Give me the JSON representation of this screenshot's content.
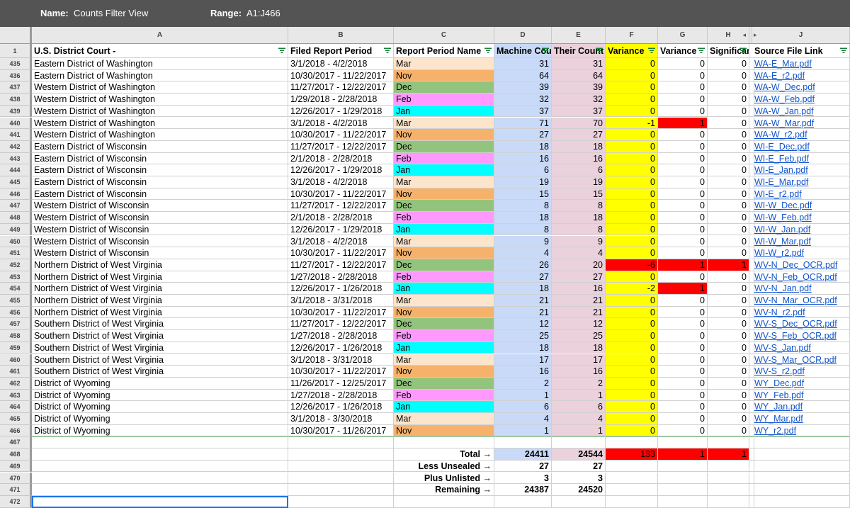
{
  "filter_view": {
    "name_label": "Name:",
    "name_value": "Counts Filter View",
    "range_label": "Range:",
    "range_value": "A1:J466"
  },
  "columns": [
    "A",
    "B",
    "C",
    "D",
    "E",
    "F",
    "G",
    "H",
    "",
    "J"
  ],
  "header_row": {
    "row_number": "1",
    "labels": [
      "U.S. District Court -",
      "Filed Report Period",
      "Report Period Name",
      "Machine Counted",
      "Their Count",
      "Variance",
      "Variance",
      "Significant",
      "",
      "Source File Link"
    ]
  },
  "colors": {
    "Mar": "#fce5cd",
    "Nov": "#f6b26b",
    "Dec": "#93c47d",
    "Feb": "#ff99ff",
    "Jan": "#00ffff",
    "machine": "#c9daf8",
    "their": "#ead1dc",
    "variance": "#ffff00",
    "red": "#ff0000",
    "link": "#1155cc"
  },
  "rows": [
    {
      "n": "435",
      "a": "Eastern District of Washington",
      "b": "3/1/2018 - 4/2/2018",
      "c": "Mar",
      "d": "31",
      "e": "31",
      "f": "0",
      "g": "0",
      "h": "0",
      "j": "WA-E_Mar.pdf"
    },
    {
      "n": "436",
      "a": "Eastern District of Washington",
      "b": "10/30/2017 - 11/22/2017",
      "c": "Nov",
      "d": "64",
      "e": "64",
      "f": "0",
      "g": "0",
      "h": "0",
      "j": "WA-E_r2.pdf"
    },
    {
      "n": "437",
      "a": "Western District of Washington",
      "b": "11/27/2017 - 12/22/2017",
      "c": "Dec",
      "d": "39",
      "e": "39",
      "f": "0",
      "g": "0",
      "h": "0",
      "j": "WA-W_Dec.pdf"
    },
    {
      "n": "438",
      "a": "Western District of Washington",
      "b": "1/29/2018 - 2/28/2018",
      "c": "Feb",
      "d": "32",
      "e": "32",
      "f": "0",
      "g": "0",
      "h": "0",
      "j": "WA-W_Feb.pdf"
    },
    {
      "n": "439",
      "a": "Western District of Washington",
      "b": "12/26/2017 - 1/29/2018",
      "c": "Jan",
      "d": "37",
      "e": "37",
      "f": "0",
      "g": "0",
      "h": "0",
      "j": "WA-W_Jan.pdf"
    },
    {
      "n": "440",
      "a": "Western District of Washington",
      "b": "3/1/2018 - 4/2/2018",
      "c": "Mar",
      "d": "71",
      "e": "70",
      "f": "-1",
      "g": "1",
      "h": "0",
      "j": "WA-W_Mar.pdf",
      "gred": true
    },
    {
      "n": "441",
      "a": "Western District of Washington",
      "b": "10/30/2017 - 11/22/2017",
      "c": "Nov",
      "d": "27",
      "e": "27",
      "f": "0",
      "g": "0",
      "h": "0",
      "j": "WA-W_r2.pdf"
    },
    {
      "n": "442",
      "a": "Eastern District of Wisconsin",
      "b": "11/27/2017 - 12/22/2017",
      "c": "Dec",
      "d": "18",
      "e": "18",
      "f": "0",
      "g": "0",
      "h": "0",
      "j": "WI-E_Dec.pdf"
    },
    {
      "n": "443",
      "a": "Eastern District of Wisconsin",
      "b": "2/1/2018 - 2/28/2018",
      "c": "Feb",
      "d": "16",
      "e": "16",
      "f": "0",
      "g": "0",
      "h": "0",
      "j": "WI-E_Feb.pdf"
    },
    {
      "n": "444",
      "a": "Eastern District of Wisconsin",
      "b": "12/26/2017 - 1/29/2018",
      "c": "Jan",
      "d": "6",
      "e": "6",
      "f": "0",
      "g": "0",
      "h": "0",
      "j": "WI-E_Jan.pdf"
    },
    {
      "n": "445",
      "a": "Eastern District of Wisconsin",
      "b": "3/1/2018 - 4/2/2018",
      "c": "Mar",
      "d": "19",
      "e": "19",
      "f": "0",
      "g": "0",
      "h": "0",
      "j": "WI-E_Mar.pdf"
    },
    {
      "n": "446",
      "a": "Eastern District of Wisconsin",
      "b": "10/30/2017 - 11/22/2017",
      "c": "Nov",
      "d": "15",
      "e": "15",
      "f": "0",
      "g": "0",
      "h": "0",
      "j": "WI-E_r2.pdf"
    },
    {
      "n": "447",
      "a": "Western District of Wisconsin",
      "b": "11/27/2017 - 12/22/2017",
      "c": "Dec",
      "d": "8",
      "e": "8",
      "f": "0",
      "g": "0",
      "h": "0",
      "j": "WI-W_Dec.pdf"
    },
    {
      "n": "448",
      "a": "Western District of Wisconsin",
      "b": "2/1/2018 - 2/28/2018",
      "c": "Feb",
      "d": "18",
      "e": "18",
      "f": "0",
      "g": "0",
      "h": "0",
      "j": "WI-W_Feb.pdf"
    },
    {
      "n": "449",
      "a": "Western District of Wisconsin",
      "b": "12/26/2017 - 1/29/2018",
      "c": "Jan",
      "d": "8",
      "e": "8",
      "f": "0",
      "g": "0",
      "h": "0",
      "j": "WI-W_Jan.pdf"
    },
    {
      "n": "450",
      "a": "Western District of Wisconsin",
      "b": "3/1/2018 - 4/2/2018",
      "c": "Mar",
      "d": "9",
      "e": "9",
      "f": "0",
      "g": "0",
      "h": "0",
      "j": "WI-W_Mar.pdf"
    },
    {
      "n": "451",
      "a": "Western District of Wisconsin",
      "b": "10/30/2017 - 11/22/2017",
      "c": "Nov",
      "d": "4",
      "e": "4",
      "f": "0",
      "g": "0",
      "h": "0",
      "j": "WI-W_r2.pdf"
    },
    {
      "n": "452",
      "a": "Northern District of West Virginia",
      "b": "11/27/2017 - 12/22/2017",
      "c": "Dec",
      "d": "26",
      "e": "20",
      "f": "-6",
      "g": "1",
      "h": "1",
      "j": "WV-N_Dec_OCR.pdf",
      "fred": true,
      "gred": true,
      "hred": true
    },
    {
      "n": "453",
      "a": "Northern District of West Virginia",
      "b": "1/27/2018 - 2/28/2018",
      "c": "Feb",
      "d": "27",
      "e": "27",
      "f": "0",
      "g": "0",
      "h": "0",
      "j": "WV-N_Feb_OCR.pdf"
    },
    {
      "n": "454",
      "a": "Northern District of West Virginia",
      "b": "12/26/2017 - 1/26/2018",
      "c": "Jan",
      "d": "18",
      "e": "16",
      "f": "-2",
      "g": "1",
      "h": "0",
      "j": "WV-N_Jan.pdf",
      "gred": true
    },
    {
      "n": "455",
      "a": "Northern District of West Virginia",
      "b": "3/1/2018 - 3/31/2018",
      "c": "Mar",
      "d": "21",
      "e": "21",
      "f": "0",
      "g": "0",
      "h": "0",
      "j": "WV-N_Mar_OCR.pdf"
    },
    {
      "n": "456",
      "a": "Northern District of West Virginia",
      "b": "10/30/2017 - 11/22/2017",
      "c": "Nov",
      "d": "21",
      "e": "21",
      "f": "0",
      "g": "0",
      "h": "0",
      "j": "WV-N_r2.pdf"
    },
    {
      "n": "457",
      "a": "Southern District of West Virginia",
      "b": "11/27/2017 - 12/22/2017",
      "c": "Dec",
      "d": "12",
      "e": "12",
      "f": "0",
      "g": "0",
      "h": "0",
      "j": "WV-S_Dec_OCR.pdf"
    },
    {
      "n": "458",
      "a": "Southern District of West Virginia",
      "b": "1/27/2018 - 2/28/2018",
      "c": "Feb",
      "d": "25",
      "e": "25",
      "f": "0",
      "g": "0",
      "h": "0",
      "j": "WV-S_Feb_OCR.pdf"
    },
    {
      "n": "459",
      "a": "Southern District of West Virginia",
      "b": "12/26/2017 - 1/26/2018",
      "c": "Jan",
      "d": "18",
      "e": "18",
      "f": "0",
      "g": "0",
      "h": "0",
      "j": "WV-S_Jan.pdf"
    },
    {
      "n": "460",
      "a": "Southern District of West Virginia",
      "b": "3/1/2018 - 3/31/2018",
      "c": "Mar",
      "d": "17",
      "e": "17",
      "f": "0",
      "g": "0",
      "h": "0",
      "j": "WV-S_Mar_OCR.pdf"
    },
    {
      "n": "461",
      "a": "Southern District of West Virginia",
      "b": "10/30/2017 - 11/22/2017",
      "c": "Nov",
      "d": "16",
      "e": "16",
      "f": "0",
      "g": "0",
      "h": "0",
      "j": "WV-S_r2.pdf"
    },
    {
      "n": "462",
      "a": "District of Wyoming",
      "b": "11/26/2017 - 12/25/2017",
      "c": "Dec",
      "d": "2",
      "e": "2",
      "f": "0",
      "g": "0",
      "h": "0",
      "j": "WY_Dec.pdf"
    },
    {
      "n": "463",
      "a": "District of Wyoming",
      "b": "1/27/2018 - 2/28/2018",
      "c": "Feb",
      "d": "1",
      "e": "1",
      "f": "0",
      "g": "0",
      "h": "0",
      "j": "WY_Feb.pdf"
    },
    {
      "n": "464",
      "a": "District of Wyoming",
      "b": "12/26/2017 - 1/26/2018",
      "c": "Jan",
      "d": "6",
      "e": "6",
      "f": "0",
      "g": "0",
      "h": "0",
      "j": "WY_Jan.pdf"
    },
    {
      "n": "465",
      "a": "District of Wyoming",
      "b": "3/1/2018 - 3/30/2018",
      "c": "Mar",
      "d": "4",
      "e": "4",
      "f": "0",
      "g": "0",
      "h": "0",
      "j": "WY_Mar.pdf"
    },
    {
      "n": "466",
      "a": "District of Wyoming",
      "b": "10/30/2017 - 11/26/2017",
      "c": "Nov",
      "d": "1",
      "e": "1",
      "f": "0",
      "g": "0",
      "h": "0",
      "j": "WY_r2.pdf"
    }
  ],
  "empty_row": "467",
  "summary_rows": [
    {
      "n": "468",
      "label": "Total →",
      "d": "24411",
      "e": "24544",
      "f": "133",
      "g": "1",
      "h": "1"
    },
    {
      "n": "469",
      "label": "Less Unsealed →",
      "d": "27",
      "e": "27"
    },
    {
      "n": "470",
      "label": "Plus Unlisted →",
      "d": "3",
      "e": "3"
    },
    {
      "n": "471",
      "label": "Remaining →",
      "d": "24387",
      "e": "24520"
    }
  ],
  "partial_row": "472"
}
